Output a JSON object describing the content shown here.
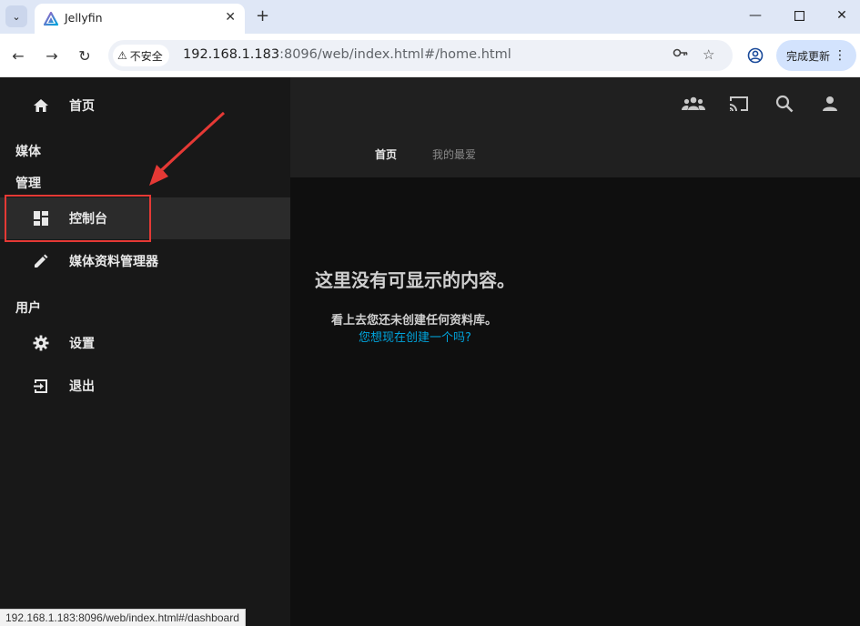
{
  "browser": {
    "tab_title": "Jellyfin",
    "new_tab_symbol": "+",
    "security_label": "不安全",
    "url_host": "192.168.1.183",
    "url_rest": ":8096/web/index.html#/home.html",
    "update_label": "完成更新"
  },
  "sidebar": {
    "home": "首页",
    "media_section": "媒体",
    "admin_section": "管理",
    "dashboard": "控制台",
    "metadata_manager": "媒体资料管理器",
    "user_section": "用户",
    "settings": "设置",
    "sign_out": "退出"
  },
  "header": {
    "tabs": [
      "首页",
      "我的最爱"
    ],
    "icons": [
      "users-icon",
      "cast-icon",
      "search-icon",
      "user-icon"
    ]
  },
  "main": {
    "empty_title": "这里没有可显示的内容。",
    "empty_sub": "看上去您还未创建任何资料库。",
    "empty_link": "您想现在创建一个吗?"
  },
  "status_bar": {
    "url": "192.168.1.183:8096/web/index.html#/dashboard"
  },
  "colors": {
    "accent": "#00a4dc",
    "annotation": "#e53935"
  }
}
